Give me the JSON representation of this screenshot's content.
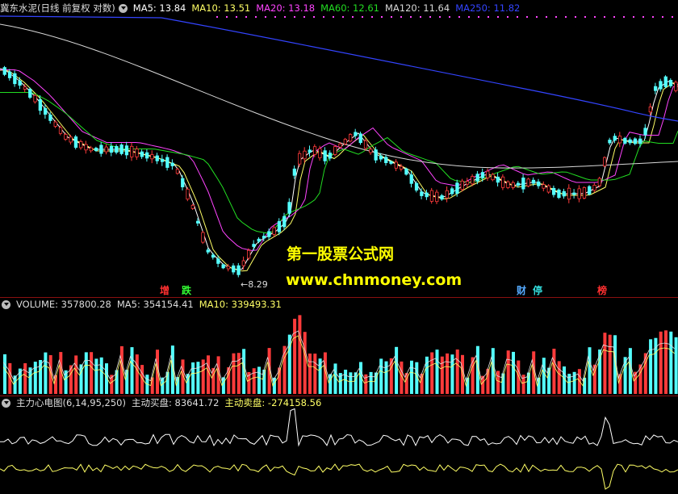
{
  "price_panel": {
    "stock_title": "冀东水泥(日线 前复权 对数)",
    "ma_labels": [
      {
        "text": "MA5: 13.84",
        "color": "#ffffff"
      },
      {
        "text": "MA10: 13.51",
        "color": "#ffff66"
      },
      {
        "text": "MA20: 13.18",
        "color": "#ff44ff"
      },
      {
        "text": "MA60: 12.61",
        "color": "#22dd22"
      },
      {
        "text": "MA120: 11.64",
        "color": "#d8d8d8"
      },
      {
        "text": "MA250: 11.82",
        "color": "#3344ff"
      }
    ],
    "low_label": "8.29",
    "markers": [
      {
        "text": "增",
        "color": "#ff3030"
      },
      {
        "text": "跌",
        "color": "#33ff33"
      },
      {
        "text": "财",
        "color": "#55aaff"
      },
      {
        "text": "停",
        "color": "#33dddd"
      },
      {
        "text": "榜",
        "color": "#ff3030"
      }
    ]
  },
  "watermark": {
    "line1": "第一股票公式网",
    "line2": "www.chnmoney.com"
  },
  "volume_panel": {
    "labels": [
      {
        "text": "VOLUME: 357800.28",
        "color": "#dddddd"
      },
      {
        "text": "MA5: 354154.41",
        "color": "#dddddd"
      },
      {
        "text": "MA10: 339493.31",
        "color": "#ffff66"
      }
    ]
  },
  "indicator_panel": {
    "labels": [
      {
        "text": "主力心电图(6,14,95,250)",
        "color": "#dddddd"
      },
      {
        "text": "主动买盘: 83641.72",
        "color": "#dddddd"
      },
      {
        "text": "主动卖盘: -274158.56",
        "color": "#ffff66"
      }
    ]
  },
  "colors": {
    "up": "#ff3b3b",
    "down": "#54ffff",
    "background": "#000000",
    "separator": "#8a1010"
  }
}
